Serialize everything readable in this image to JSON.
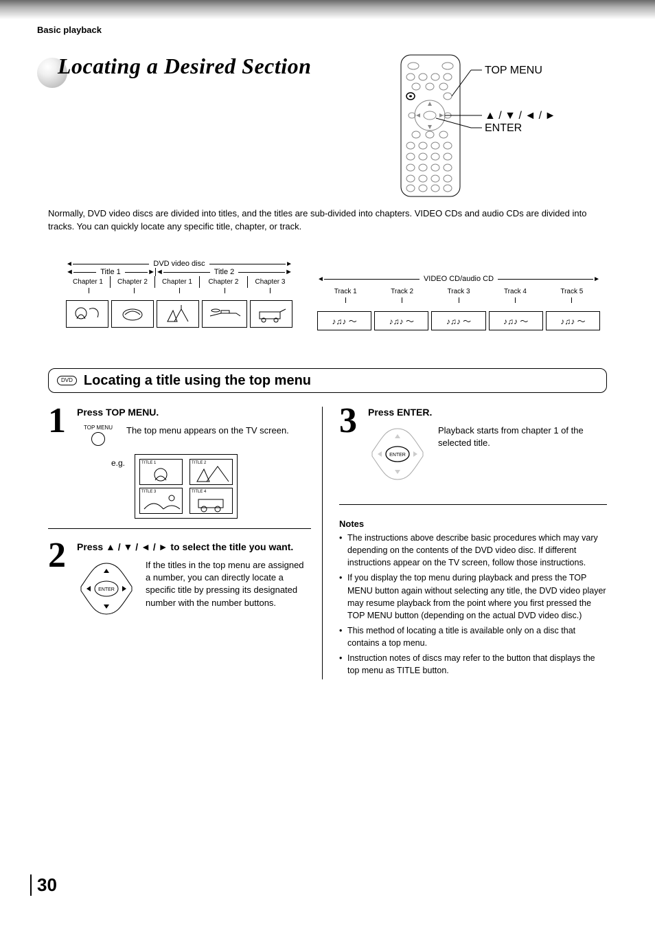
{
  "header": {
    "breadcrumb": "Basic playback"
  },
  "title": "Locating a Desired Section",
  "remote": {
    "label_topmenu": "TOP MENU",
    "label_arrows": "▲ / ▼ / ◄ / ►",
    "label_enter": "ENTER"
  },
  "intro": "Normally, DVD video discs are divided into titles, and the titles are sub-divided into chapters. VIDEO CDs and audio CDs are divided into tracks. You can quickly locate any specific title, chapter, or track.",
  "dvd_diagram": {
    "label": "DVD video disc",
    "title1": "Title 1",
    "title2": "Title 2",
    "chapters": [
      "Chapter 1",
      "Chapter 2",
      "Chapter 1",
      "Chapter 2",
      "Chapter 3"
    ]
  },
  "cd_diagram": {
    "label": "VIDEO CD/audio CD",
    "tracks": [
      "Track 1",
      "Track 2",
      "Track 3",
      "Track 4",
      "Track 5"
    ]
  },
  "section": {
    "pill": "DVD",
    "heading": "Locating a title using the top menu"
  },
  "steps": {
    "s1": {
      "num": "1",
      "head": "Press TOP MENU.",
      "btn_label": "TOP MENU",
      "desc": "The top menu appears on the TV screen.",
      "eg": "e.g.",
      "titles": [
        "TITLE 1",
        "TITLE 2",
        "TITLE 3",
        "TITLE 4"
      ]
    },
    "s2": {
      "num": "2",
      "head": "Press ▲ / ▼ / ◄ / ► to select the title you want.",
      "desc": "If the titles in the top menu are assigned a number, you can directly locate a specific title by pressing its designated number with the number buttons.",
      "enter": "ENTER"
    },
    "s3": {
      "num": "3",
      "head": "Press ENTER.",
      "desc": "Playback starts from chapter 1 of the selected title.",
      "enter": "ENTER"
    }
  },
  "notes": {
    "head": "Notes",
    "items": [
      "The instructions above describe basic procedures which may vary depending on the contents of the DVD video disc. If different instructions appear on the TV screen, follow those instructions.",
      "If you display the top menu during playback and press the TOP MENU button again without selecting any title, the DVD video player may resume playback from the point where you first pressed the TOP MENU button (depending on the actual DVD video disc.)",
      "This method of locating a title is available only on a disc that contains a top menu.",
      "Instruction notes of discs may refer to the button that displays the top menu as TITLE button."
    ]
  },
  "page_number": "30",
  "glyphs": {
    "notes": "♪♫♪ ～"
  }
}
